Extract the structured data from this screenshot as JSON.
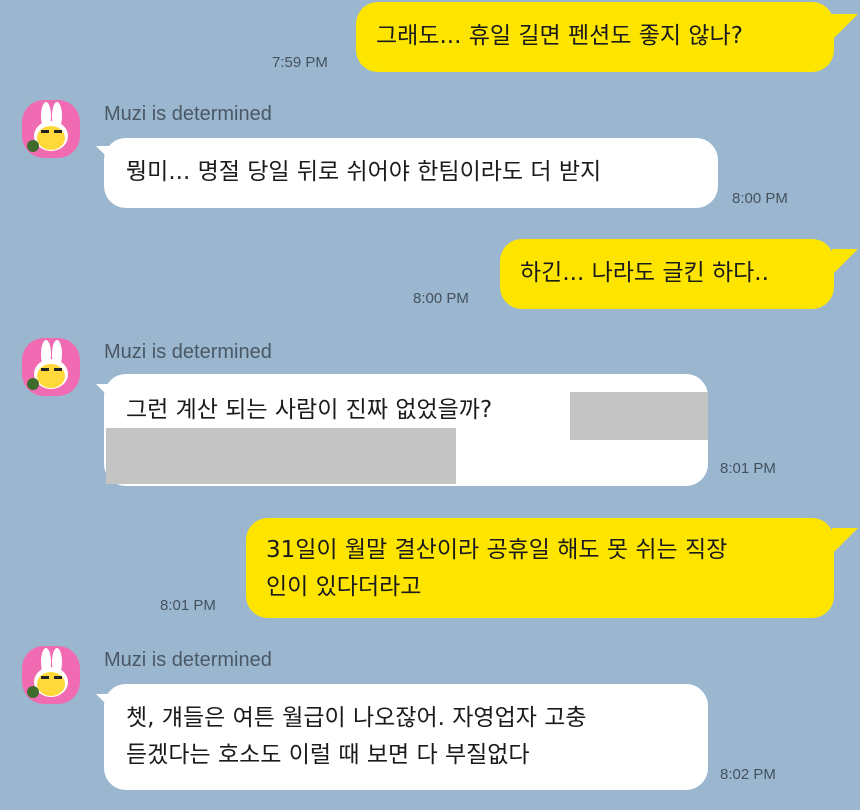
{
  "chat": {
    "messages": [
      {
        "text": "그래도... 휴일 길면 펜션도 좋지 않나?",
        "time": "7:59 PM"
      },
      {
        "sender": "Muzi is determined",
        "text": "뭥미... 명절 당일 뒤로 쉬어야 한팀이라도 더 받지",
        "time": "8:00 PM"
      },
      {
        "text": "하긴... 나라도 글킨 하다..",
        "time": "8:00 PM"
      },
      {
        "sender": "Muzi is determined",
        "text": "그런 계산 되는 사람이 진짜 없었을까?",
        "time": "8:01 PM"
      },
      {
        "text_line1": "31일이 월말 결산이라 공휴일 해도 못 쉬는 직장",
        "text_line2": "인이 있다더라고",
        "time": "8:01 PM"
      },
      {
        "sender": "Muzi is determined",
        "text_line1": "쳇, 걔들은 여튼 월급이 나오잖어. 자영업자 고충",
        "text_line2": "듣겠다는 호소도 이럴 때 보면 다 부질없다",
        "time": "8:02 PM"
      }
    ]
  },
  "colors": {
    "background": "#9bb7cf",
    "my_bubble": "#fde500",
    "their_bubble": "#ffffff",
    "avatar_bg": "#f06bb2",
    "redaction": "#c4c4c4"
  },
  "icons": {
    "avatar": "muzi-avatar-icon"
  }
}
